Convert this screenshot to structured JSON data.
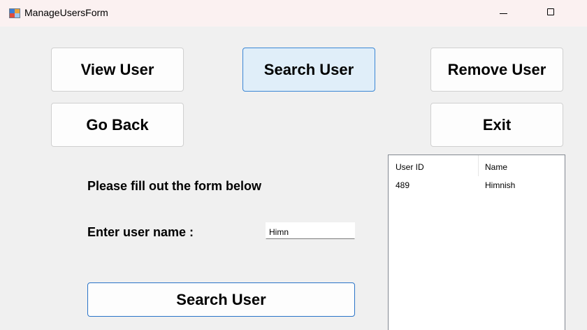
{
  "window": {
    "title": "ManageUsersForm"
  },
  "buttons": {
    "view_user": "View User",
    "search_user_tab": "Search User",
    "remove_user": "Remove User",
    "go_back": "Go Back",
    "exit": "Exit",
    "search_submit": "Search User"
  },
  "form": {
    "instruction": "Please fill out the form below",
    "username_label": "Enter user name :",
    "username_value": "Himn"
  },
  "results": {
    "columns": [
      "User ID",
      "Name"
    ],
    "rows": [
      {
        "user_id": "489",
        "name": "Himnish"
      }
    ]
  },
  "colors": {
    "window_bg": "#f0f0f0",
    "titlebar_bg": "#fbf1f1",
    "active_button_bg": "#e0eef9",
    "accent_border": "#3a86d4"
  },
  "icons": {
    "app": "form-app-icon",
    "minimize": "minimize-icon",
    "maximize": "maximize-icon"
  }
}
